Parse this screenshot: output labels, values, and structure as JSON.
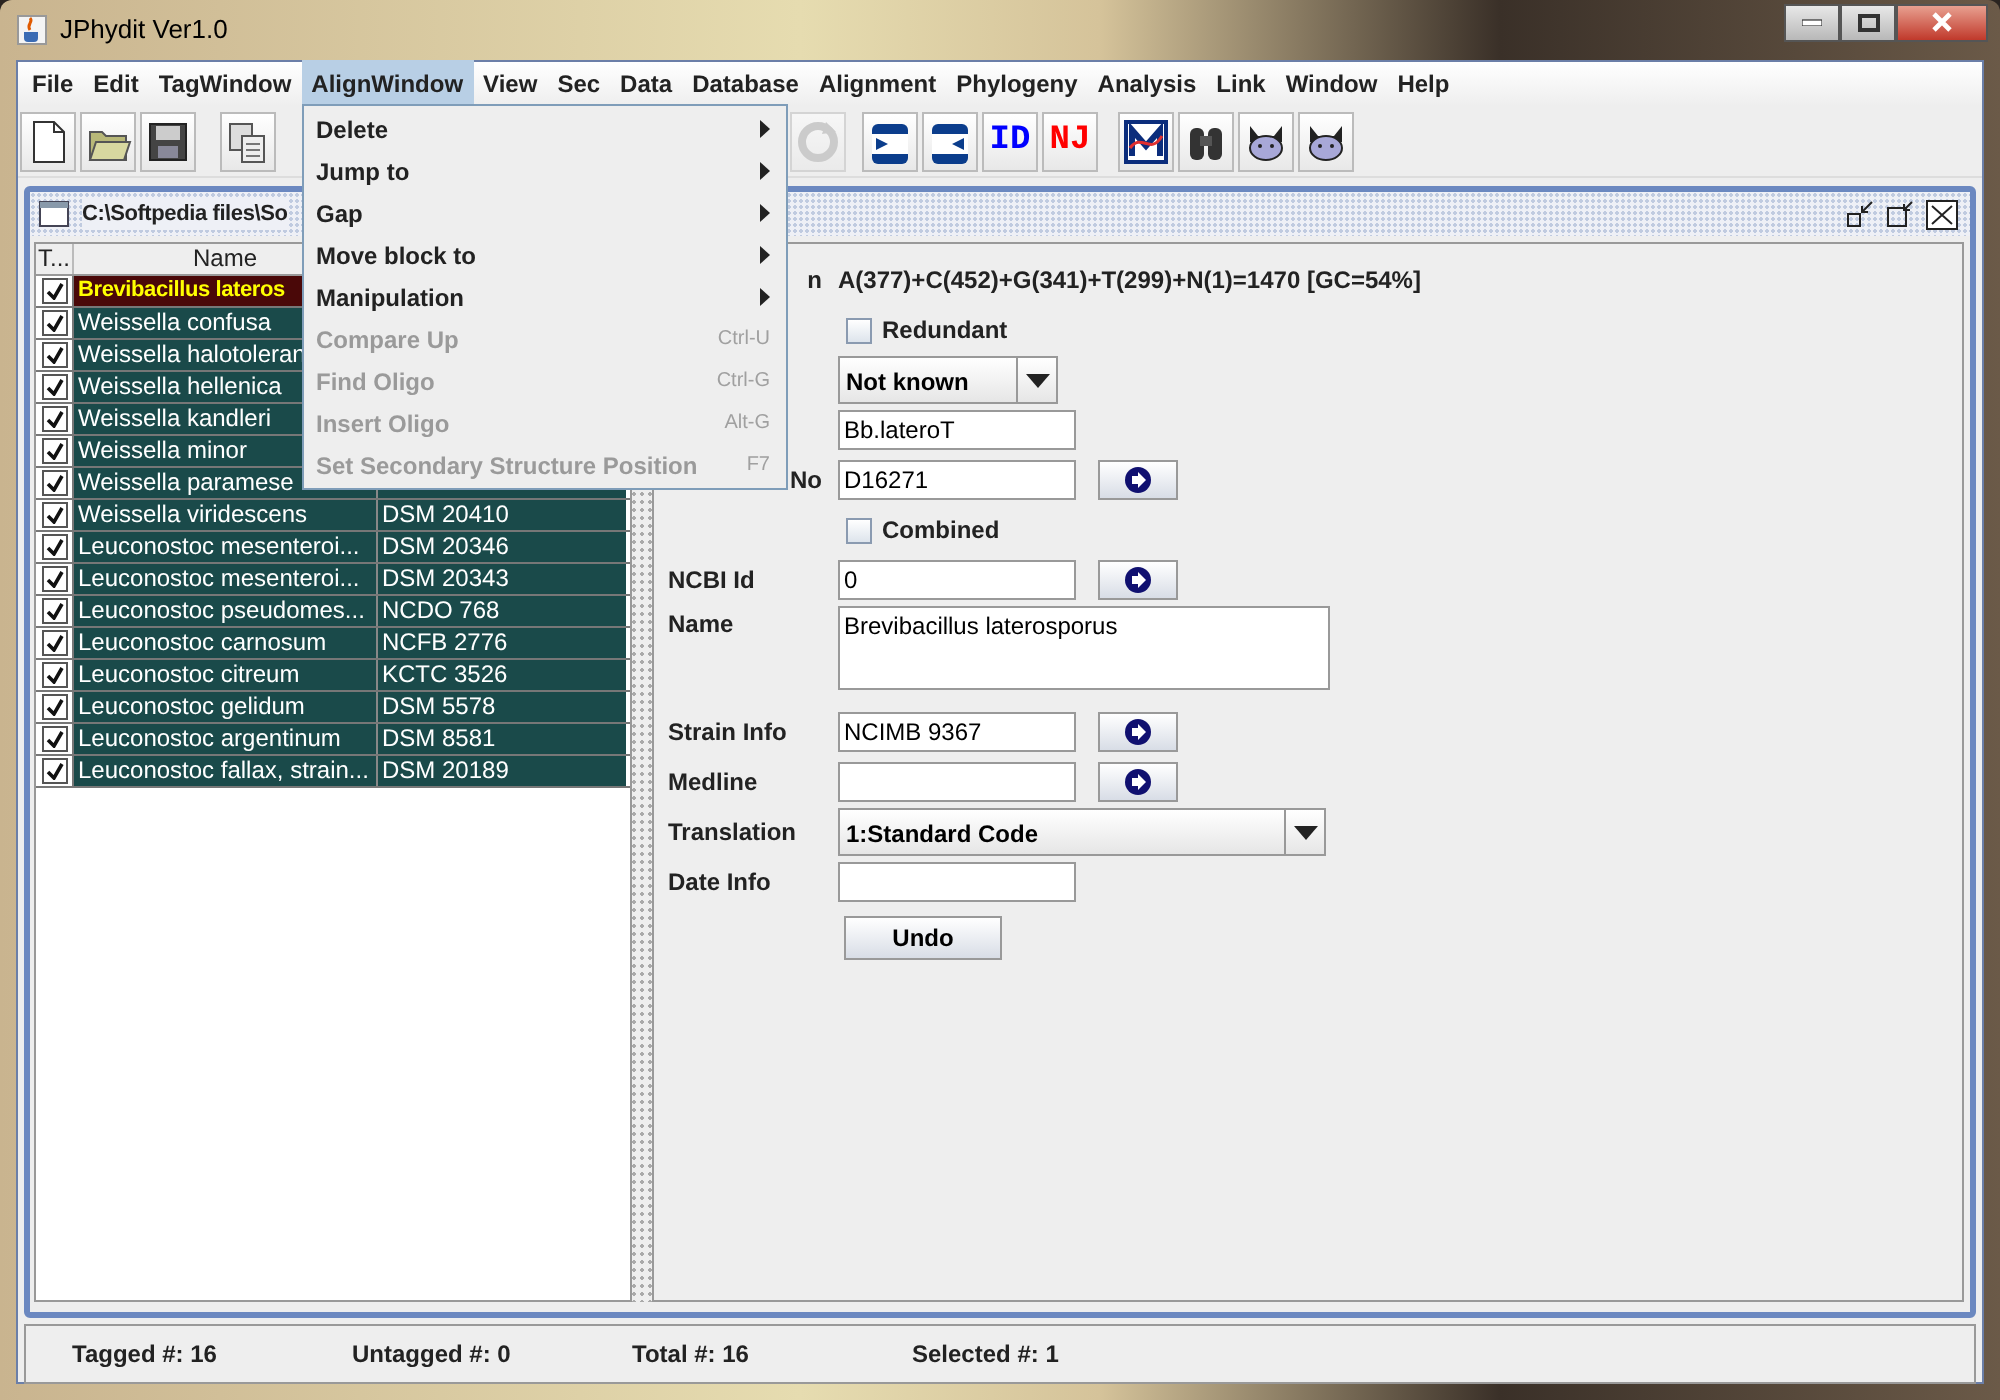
{
  "window": {
    "title": "JPhydit Ver1.0"
  },
  "menu_bar": [
    {
      "label": "File",
      "selected": false
    },
    {
      "label": "Edit",
      "selected": false
    },
    {
      "label": "TagWindow",
      "selected": false
    },
    {
      "label": "AlignWindow",
      "selected": true
    },
    {
      "label": "View",
      "selected": false
    },
    {
      "label": "Sec",
      "selected": false
    },
    {
      "label": "Data",
      "selected": false
    },
    {
      "label": "Database",
      "selected": false
    },
    {
      "label": "Alignment",
      "selected": false
    },
    {
      "label": "Phylogeny",
      "selected": false
    },
    {
      "label": "Analysis",
      "selected": false
    },
    {
      "label": "Link",
      "selected": false
    },
    {
      "label": "Window",
      "selected": false
    },
    {
      "label": "Help",
      "selected": false
    }
  ],
  "toolbar": [
    {
      "items": [
        {
          "kind": "new",
          "disabled": false
        },
        {
          "kind": "open",
          "disabled": false
        },
        {
          "kind": "save",
          "disabled": false
        }
      ]
    },
    {
      "items": [
        {
          "kind": "copy",
          "disabled": false
        }
      ]
    },
    {
      "items": [
        {
          "kind": "redo",
          "disabled": true
        }
      ]
    },
    {
      "items": [
        {
          "kind": "import",
          "disabled": false
        },
        {
          "kind": "export",
          "disabled": false
        },
        {
          "kind": "text",
          "label": "ID",
          "color": "#0000ff",
          "disabled": false
        },
        {
          "kind": "text",
          "label": "NJ",
          "color": "#ff0000",
          "disabled": false
        }
      ]
    },
    {
      "items": [
        {
          "kind": "chart",
          "disabled": false
        },
        {
          "kind": "binoculars",
          "disabled": false
        },
        {
          "kind": "cat",
          "disabled": false
        },
        {
          "kind": "cat",
          "disabled": false
        }
      ]
    }
  ],
  "open_menu": {
    "items": [
      {
        "label": "Delete",
        "submenu": true,
        "disabled": false
      },
      {
        "label": "Jump to",
        "submenu": true,
        "disabled": false
      },
      {
        "label": "Gap",
        "submenu": true,
        "disabled": false
      },
      {
        "label": "Move block to",
        "submenu": true,
        "disabled": false
      },
      {
        "label": "Manipulation",
        "submenu": true,
        "disabled": false
      },
      {
        "label": "Compare Up",
        "shortcut": "Ctrl-U",
        "submenu": false,
        "disabled": true
      },
      {
        "label": "Find Oligo",
        "shortcut": "Ctrl-G",
        "submenu": false,
        "disabled": true
      },
      {
        "label": "Insert Oligo",
        "shortcut": "Alt-G",
        "submenu": false,
        "disabled": true
      },
      {
        "label": "Set Secondary Structure Position",
        "shortcut": "F7",
        "submenu": false,
        "disabled": true
      }
    ]
  },
  "document_window": {
    "title": "C:\\Softpedia files\\So"
  },
  "table": {
    "columns": [
      "T...",
      "Name"
    ],
    "rows": [
      {
        "checked": true,
        "name": "Brevibacillus lateros",
        "selected": true
      },
      {
        "checked": true,
        "name": "Weissella confusa",
        "selected": false
      },
      {
        "checked": true,
        "name": "Weissella halotoleran",
        "selected": false
      },
      {
        "checked": true,
        "name": "Weissella hellenica",
        "selected": false
      },
      {
        "checked": true,
        "name": "Weissella kandleri",
        "selected": false
      },
      {
        "checked": true,
        "name": "Weissella minor",
        "selected": false
      },
      {
        "checked": true,
        "name": "Weissella paramese",
        "selected": false
      },
      {
        "checked": true,
        "name": "Weissella viridescens",
        "strain": "DSM 20410",
        "selected": false
      },
      {
        "checked": true,
        "name": "Leuconostoc mesenteroi...",
        "strain": "DSM 20346",
        "selected": false
      },
      {
        "checked": true,
        "name": "Leuconostoc mesenteroi...",
        "strain": "DSM 20343",
        "selected": false
      },
      {
        "checked": true,
        "name": "Leuconostoc pseudomes...",
        "strain": "NCDO 768",
        "selected": false
      },
      {
        "checked": true,
        "name": "Leuconostoc carnosum",
        "strain": "NCFB 2776",
        "selected": false
      },
      {
        "checked": true,
        "name": "Leuconostoc citreum",
        "strain": "KCTC 3526",
        "selected": false
      },
      {
        "checked": true,
        "name": "Leuconostoc gelidum",
        "strain": "DSM 5578",
        "selected": false
      },
      {
        "checked": true,
        "name": "Leuconostoc argentinum",
        "strain": "DSM 8581",
        "selected": false
      },
      {
        "checked": true,
        "name": "Leuconostoc fallax, strain...",
        "strain": "DSM 20189",
        "selected": false
      }
    ]
  },
  "details": {
    "rows": [
      {
        "kind": "info",
        "label": "n",
        "cut": true,
        "value": "A(377)+C(452)+G(341)+T(299)+N(1)=1470  [GC=54%]"
      },
      {
        "kind": "checkbox",
        "text": "Redundant",
        "checked": false
      },
      {
        "kind": "select",
        "value": "Not known"
      },
      {
        "kind": "text",
        "value": "Bb.lateroT"
      },
      {
        "kind": "text",
        "label": "No",
        "cut": true,
        "value": "D16271",
        "go_button": true
      },
      {
        "kind": "checkbox",
        "text": "Combined",
        "checked": false
      },
      {
        "kind": "text",
        "label": "NCBI Id",
        "value": "0",
        "go_button": true
      },
      {
        "kind": "textarea",
        "label": "Name",
        "value": "Brevibacillus laterosporus"
      },
      {
        "kind": "text",
        "label": "Strain Info",
        "value": "NCIMB 9367",
        "go_button": true
      },
      {
        "kind": "text",
        "label": "Medline",
        "go_button": true
      },
      {
        "kind": "wide-select",
        "label": "Translation",
        "value": "1:Standard Code"
      },
      {
        "kind": "text",
        "label": "Date Info"
      }
    ],
    "undo_button": "Undo"
  },
  "status_bar": [
    "Tagged #: 16",
    "Untagged #: 0",
    "Total #: 16",
    "Selected #: 1"
  ]
}
